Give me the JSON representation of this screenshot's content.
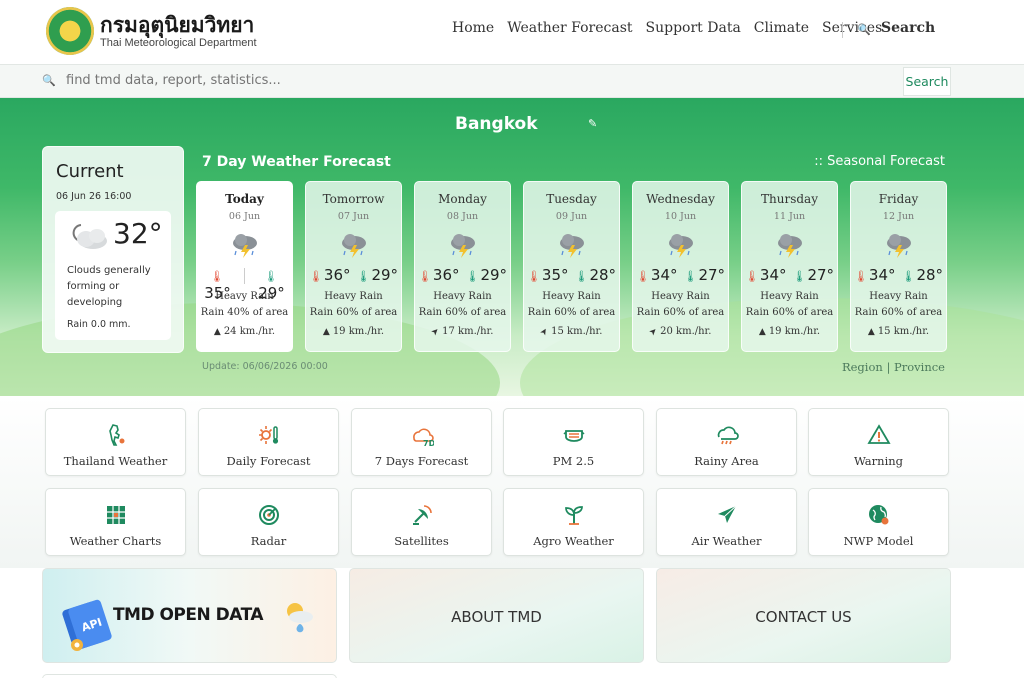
{
  "header": {
    "logo_th": "กรมอุตุนิยมวิทยา",
    "logo_en": "Thai Meteorological Department",
    "nav": [
      "Home",
      "Weather Forecast",
      "Support Data",
      "Climate",
      "Services"
    ],
    "search_label": "Search"
  },
  "searchbar": {
    "placeholder": "find tmd data, report, statistics...",
    "button": "Search"
  },
  "hero": {
    "city": "Bangkok",
    "current": {
      "title": "Current",
      "datetime": "06 Jun 26 16:00",
      "temp": "32°",
      "description": "Clouds generally forming or developing",
      "rain": "Rain 0.0 mm.",
      "icon": "partly-cloudy-icon"
    },
    "forecast_title": "7 Day Weather Forecast",
    "seasonal_link": ":: Seasonal Forecast",
    "days": [
      {
        "name": "Today",
        "date": "06 Jun",
        "max": "35°",
        "min": "29°",
        "cond": "Heavy Rain",
        "rain": "Rain 40% of area",
        "wind": "24 km./hr.",
        "wind_dir": "▲"
      },
      {
        "name": "Tomorrow",
        "date": "07 Jun",
        "max": "36°",
        "min": "29°",
        "cond": "Heavy Rain",
        "rain": "Rain 60% of area",
        "wind": "19 km./hr.",
        "wind_dir": "▲"
      },
      {
        "name": "Monday",
        "date": "08 Jun",
        "max": "36°",
        "min": "29°",
        "cond": "Heavy Rain",
        "rain": "Rain 60% of area",
        "wind": "17 km./hr.",
        "wind_dir": "➤"
      },
      {
        "name": "Tuesday",
        "date": "09 Jun",
        "max": "35°",
        "min": "28°",
        "cond": "Heavy Rain",
        "rain": "Rain 60% of area",
        "wind": "15 km./hr.",
        "wind_dir": "➤"
      },
      {
        "name": "Wednesday",
        "date": "10 Jun",
        "max": "34°",
        "min": "27°",
        "cond": "Heavy Rain",
        "rain": "Rain 60% of area",
        "wind": "20 km./hr.",
        "wind_dir": "➤"
      },
      {
        "name": "Thursday",
        "date": "11 Jun",
        "max": "34°",
        "min": "27°",
        "cond": "Heavy Rain",
        "rain": "Rain 60% of area",
        "wind": "19 km./hr.",
        "wind_dir": "▲"
      },
      {
        "name": "Friday",
        "date": "12 Jun",
        "max": "34°",
        "min": "28°",
        "cond": "Heavy Rain",
        "rain": "Rain 60% of area",
        "wind": "15 km./hr.",
        "wind_dir": "▲"
      }
    ],
    "update": "Update: 06/06/2026 00:00",
    "region": "Region",
    "province": "Province"
  },
  "quick_links": [
    {
      "label": "Thailand Weather",
      "icon": "thailand-map-icon"
    },
    {
      "label": "Daily Forecast",
      "icon": "sun-thermometer-icon"
    },
    {
      "label": "7 Days Forecast",
      "icon": "seven-day-icon"
    },
    {
      "label": "PM 2.5",
      "icon": "mask-icon"
    },
    {
      "label": "Rainy Area",
      "icon": "rain-cloud-icon"
    },
    {
      "label": "Warning",
      "icon": "warning-icon"
    },
    {
      "label": "Weather Charts",
      "icon": "chart-grid-icon"
    },
    {
      "label": "Radar",
      "icon": "radar-icon"
    },
    {
      "label": "Satellites",
      "icon": "satellite-icon"
    },
    {
      "label": "Agro Weather",
      "icon": "sprout-icon"
    },
    {
      "label": "Air Weather",
      "icon": "airplane-icon"
    },
    {
      "label": "NWP Model",
      "icon": "globe-icon"
    }
  ],
  "banners": {
    "open_data": "TMD OPEN DATA",
    "about": "ABOUT TMD",
    "contact": "CONTACT US",
    "api_badge": "API"
  },
  "colors": {
    "brand_green": "#1f8a5f",
    "hot": "#e2462f",
    "cold": "#1a9b7a",
    "icon_orange": "#e8743b"
  }
}
